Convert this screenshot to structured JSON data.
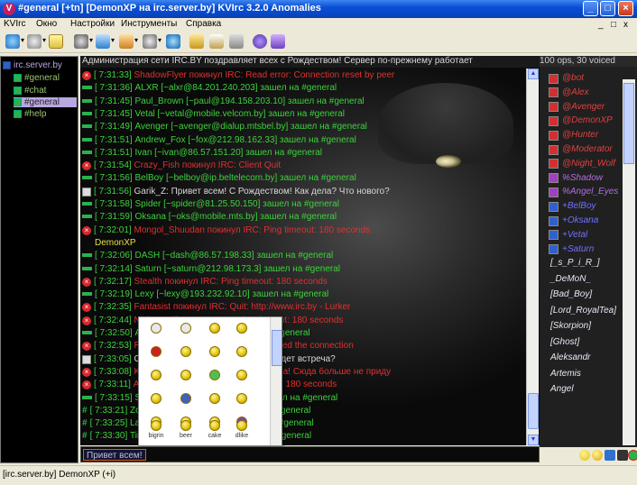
{
  "window": {
    "title": "#general [+tn] [DemonXP на irc.server.by] KVIrc 3.2.0 Anomalies",
    "app_icon": "V",
    "minimize_glyph": "_",
    "maximize_glyph": "□",
    "close_glyph": "×"
  },
  "menu": {
    "items": [
      "KVIrc",
      "Окно",
      "Настройки",
      "Инструменты",
      "Справка"
    ],
    "mdi_minimize": "_",
    "mdi_restore": "□",
    "mdi_close": "x"
  },
  "toolbar": {
    "icons": [
      "connect-icon",
      "options-icon",
      "window-list-icon",
      "join-icon",
      "channel-icon",
      "tools-icon",
      "actions-icon",
      "network-icon",
      "script-icon",
      "addons-icon",
      "help-icon",
      "about-icon"
    ]
  },
  "tree": {
    "root": "irc.server.by",
    "nodes": [
      "#general",
      "#chat",
      "#general",
      "#help"
    ],
    "selected_index": 2
  },
  "chat": {
    "topic": "Администрация сети IRC.BY поздравляет всех с Рождеством! Сервер по-прежнему работает",
    "lines": [
      {
        "icon": "quit",
        "time": "[ 7:31:33]",
        "text": "ShadowFlyer покинул IRC: Read error: Connection reset by peer",
        "color": "red"
      },
      {
        "icon": "join",
        "time": "[ 7:31:36]",
        "text": "ALXR [~alxr@84.201.240.203] зашел на #general",
        "color": "green"
      },
      {
        "icon": "join",
        "time": "[ 7:31:45]",
        "text": "Paul_Brown [~paul@194.158.203.10] зашел на #general",
        "color": "green"
      },
      {
        "icon": "join",
        "time": "[ 7:31:45]",
        "text": "Vetal [~vetal@mobile.velcom.by] зашел на #general",
        "color": "green"
      },
      {
        "icon": "join",
        "time": "[ 7:31:49]",
        "text": "Avenger [~avenger@dialup.mtsbel.by] зашел на #general",
        "color": "green"
      },
      {
        "icon": "join",
        "time": "[ 7:31:51]",
        "text": "Andrew_Fox [~fox@212.98.162.33] зашел на #general",
        "color": "green"
      },
      {
        "icon": "join",
        "time": "[ 7:31:51]",
        "text": "Ivan [~ivan@86.57.151.20] зашел на #general",
        "color": "green"
      },
      {
        "icon": "quit",
        "time": "[ 7:31:54]",
        "text": "Crazy_Fish покинул IRC: Client Quit",
        "color": "red"
      },
      {
        "icon": "join",
        "time": "[ 7:31:56]",
        "text": "BelBoy [~belboy@ip.beltelecom.by] зашел на #general",
        "color": "green"
      },
      {
        "icon": "note",
        "time": "[ 7:31:56]",
        "text": "Garik_Z: Привет всем! С Рождеством! Как дела? Что нового?",
        "color": "gray"
      },
      {
        "icon": "join",
        "time": "[ 7:31:58]",
        "text": "Spider [~spider@81.25.50.150] зашел на #general",
        "color": "green"
      },
      {
        "icon": "join",
        "time": "[ 7:31:59]",
        "text": "Oksana [~oks@mobile.mts.by] зашел на #general",
        "color": "green"
      },
      {
        "icon": "quit",
        "time": "[ 7:32:01]",
        "text": "Mongol_Shuudan покинул IRC: Ping timeout: 180 seconds",
        "color": "red",
        "wrap": "DemonXP"
      },
      {
        "icon": "join",
        "time": "[ 7:32:06]",
        "text": "DASH [~dash@86.57.198.33] зашел на #general",
        "color": "green"
      },
      {
        "icon": "join",
        "time": "[ 7:32:14]",
        "text": "Saturn [~saturn@212.98.173.3] зашел на #general",
        "color": "green"
      },
      {
        "icon": "quit",
        "time": "[ 7:32:17]",
        "text": "Stealth покинул IRC: Ping timeout: 180 seconds",
        "color": "red"
      },
      {
        "icon": "join",
        "time": "[ 7:32:19]",
        "text": "Lexy [~lexy@193.232.92.10] зашел на #general",
        "color": "green"
      },
      {
        "icon": "quit",
        "time": "[ 7:32:35]",
        "text": "Fantasist покинул IRC: Quit: http://www.irc.by - Lurker",
        "color": "red"
      },
      {
        "icon": "quit",
        "time": "[ 7:32:44]",
        "text": "Night_Wolf покинул IRC: Ping timeout: 180 seconds",
        "color": "red"
      },
      {
        "icon": "join",
        "time": "[ 7:32:50]",
        "text": "Alisa [~alisa@dialup.by] зашел на #general",
        "color": "green"
      },
      {
        "icon": "quit",
        "time": "[ 7:32:53]",
        "text": "Rikki покинул IRC: Remote host closed the connection",
        "color": "red"
      },
      {
        "icon": "note",
        "time": "[ 7:33:05]",
        "text": "Garik_Z: Кто-нибудь знает, когда будет встреча?",
        "color": "gray"
      },
      {
        "icon": "quit",
        "time": "[ 7:33:08]",
        "text": "Koshak покинул IRC: Quit: Всем пока! Сюда больше не приду",
        "color": "red"
      },
      {
        "icon": "quit",
        "time": "[ 7:33:11]",
        "text": "Amadeus покинул IRC: Ping timeout: 180 seconds",
        "color": "red"
      },
      {
        "icon": "join",
        "time": "[ 7:33:15]",
        "text": "Sun_Ray [~sunray@86.57.1.1] зашел на #general",
        "color": "green"
      },
      {
        "icon": "hash",
        "time": "[ 7:33:21]",
        "text": "Zorro [~zorro@86.57.2.2] зашел на #general",
        "color": "green"
      },
      {
        "icon": "hash",
        "time": "[ 7:33:25]",
        "text": "Laska [~laska@86.57.3.3] зашел на #general",
        "color": "green"
      },
      {
        "icon": "hash",
        "time": "[ 7:33:30]",
        "text": "Timur [~timur@86.57.4.4] зашел на #general",
        "color": "green"
      }
    ]
  },
  "emoji_picker": {
    "captions": [
      "",
      "",
      "",
      "",
      "",
      "",
      "",
      "",
      "",
      "",
      "",
      "",
      "",
      "",
      "",
      "",
      "",
      "",
      "",
      "",
      "bigrin",
      "beer",
      "cake",
      "dlike"
    ]
  },
  "input": {
    "value": "Привет всем!"
  },
  "nicklist": {
    "header": "100 ops, 30 voiced",
    "nicks": [
      {
        "kind": "op",
        "name": "@bot"
      },
      {
        "kind": "op",
        "name": "@Alex"
      },
      {
        "kind": "op",
        "name": "@Avenger"
      },
      {
        "kind": "op",
        "name": "@DemonXP"
      },
      {
        "kind": "op",
        "name": "@Hunter"
      },
      {
        "kind": "op",
        "name": "@Moderator"
      },
      {
        "kind": "op",
        "name": "@Night_Wolf"
      },
      {
        "kind": "half",
        "name": "%Shadow"
      },
      {
        "kind": "half",
        "name": "%Angel_Eyes"
      },
      {
        "kind": "voice",
        "name": "+BelBoy"
      },
      {
        "kind": "voice",
        "name": "+Oksana"
      },
      {
        "kind": "voice",
        "name": "+Vetal"
      },
      {
        "kind": "voice",
        "name": "+Saturn"
      },
      {
        "kind": "plain",
        "name": "[_s_P_i_R_]"
      },
      {
        "kind": "plain",
        "name": "_DeMoN_"
      },
      {
        "kind": "plain",
        "name": "[Bad_Boy]"
      },
      {
        "kind": "plain",
        "name": "[Lord_RoyalTea]"
      },
      {
        "kind": "plain",
        "name": "[Skorpion]"
      },
      {
        "kind": "plain",
        "name": "[Ghost]"
      },
      {
        "kind": "plain",
        "name": "Aleksandr"
      },
      {
        "kind": "plain",
        "name": "Artemis"
      },
      {
        "kind": "plain",
        "name": "Angel"
      }
    ]
  },
  "statusbar": {
    "text": "[irc.server.by] DemonXP (+i)"
  }
}
